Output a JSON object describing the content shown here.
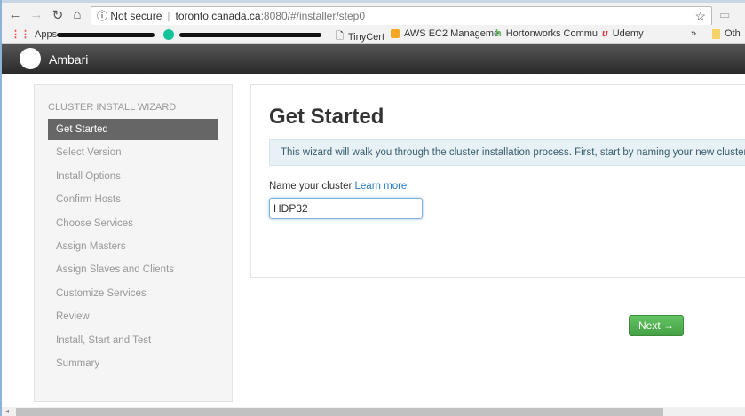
{
  "browser": {
    "url_security": "Not secure",
    "url_host": "toronto.canada.ca",
    "url_path": ":8080/#/installer/step0",
    "bookmarks": [
      "Apps",
      "TinyCert",
      "AWS EC2 Manageme",
      "Hortonworks Commu",
      "Udemy",
      "»",
      "Oth"
    ]
  },
  "app": {
    "brand": "Ambari"
  },
  "sidebar": {
    "title": "Cluster Install Wizard",
    "steps": [
      "Get Started",
      "Select Version",
      "Install Options",
      "Confirm Hosts",
      "Choose Services",
      "Assign Masters",
      "Assign Slaves and Clients",
      "Customize Services",
      "Review",
      "Install, Start and Test",
      "Summary"
    ],
    "active": 0
  },
  "main": {
    "title": "Get Started",
    "info": "This wizard will walk you through the cluster installation process. First, start by naming your new cluster.",
    "field_label": "Name your cluster",
    "learn_more": "Learn more",
    "cluster_name": "HDP32",
    "next": "Next →"
  },
  "colors": {
    "accent_green": "#51a351",
    "link": "#2a7ac0",
    "header": "#333333"
  }
}
